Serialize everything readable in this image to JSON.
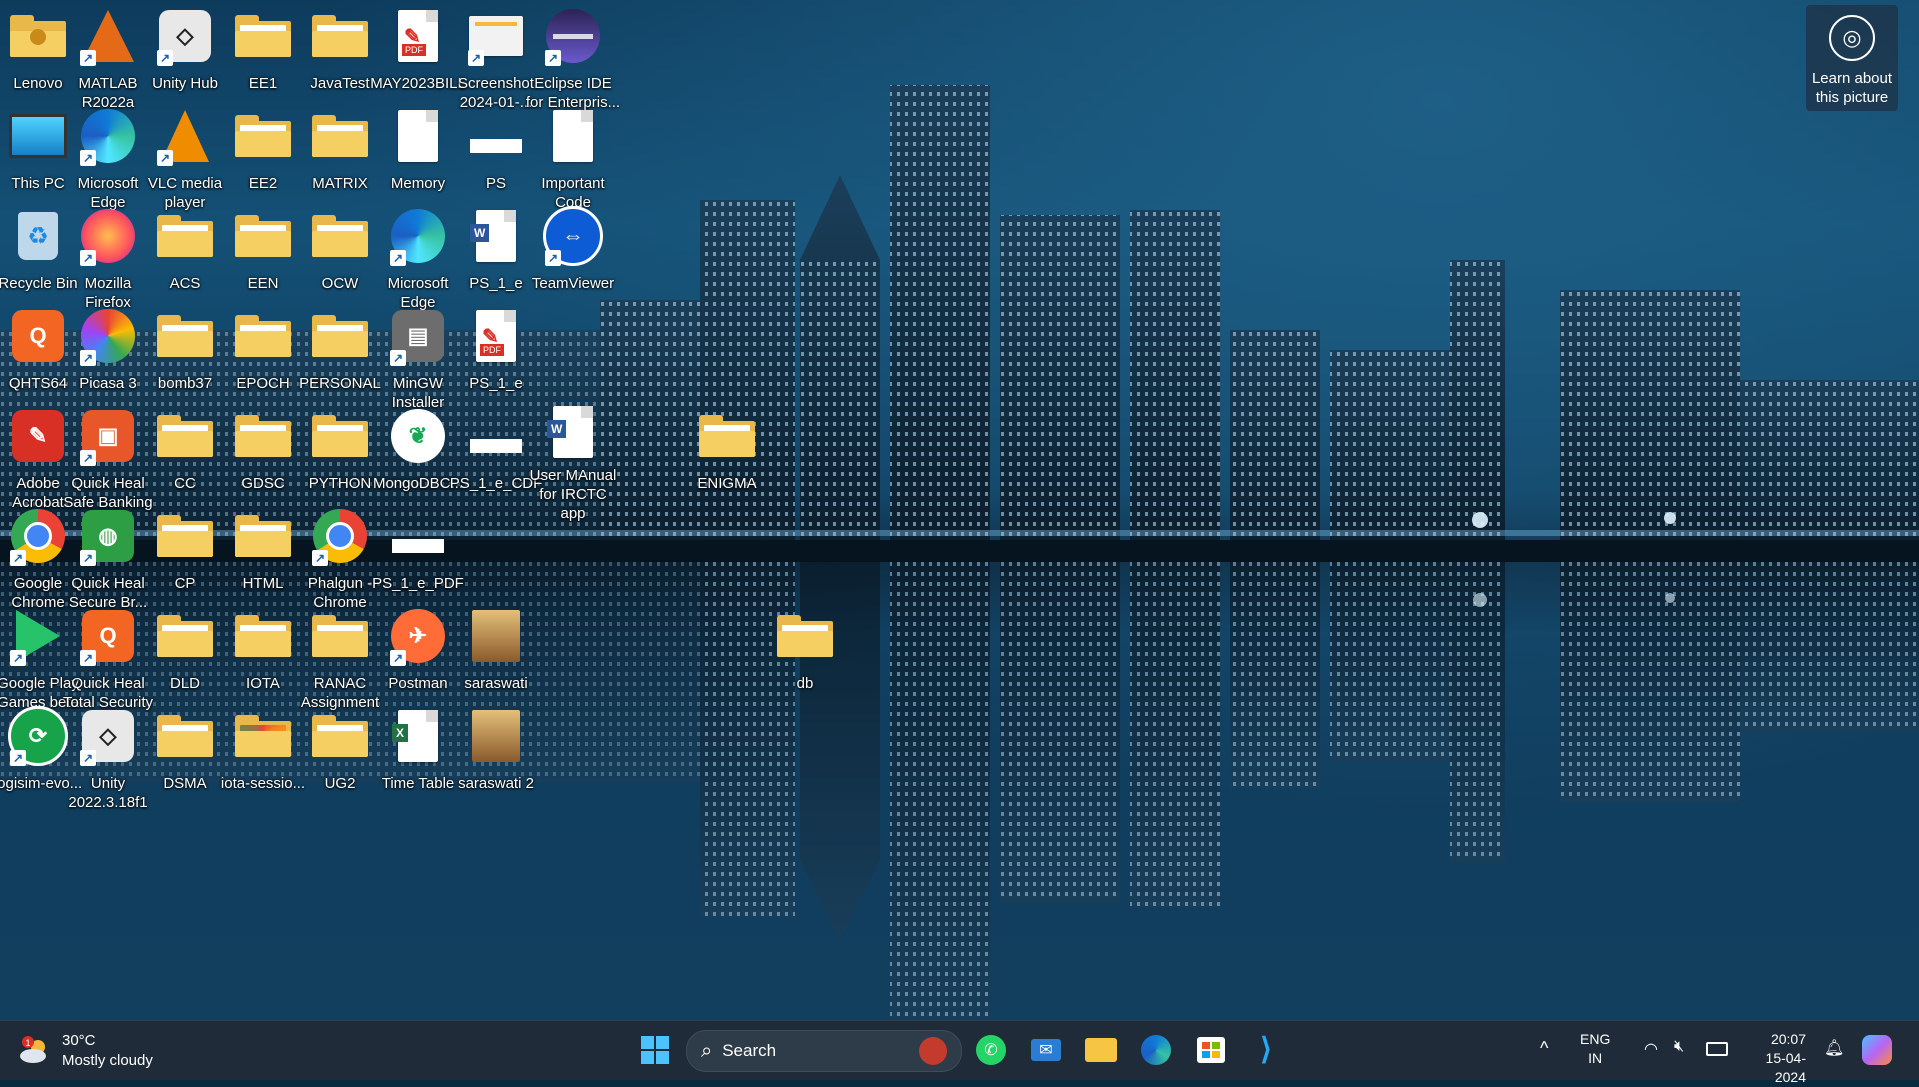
{
  "desktop": {
    "icons": [
      {
        "label": "Lenovo",
        "kind": "user-folder",
        "shortcut": false
      },
      {
        "label": "MATLAB R2022a",
        "kind": "matlab",
        "shortcut": true
      },
      {
        "label": "Unity Hub",
        "kind": "unity",
        "shortcut": true
      },
      {
        "label": "EE1",
        "kind": "folder",
        "shortcut": false
      },
      {
        "label": "JavaTest",
        "kind": "folder",
        "shortcut": false
      },
      {
        "label": "MAY2023BILL",
        "kind": "pdf",
        "shortcut": false
      },
      {
        "label": "Screenshot 2024-01-...",
        "kind": "image",
        "shortcut": true
      },
      {
        "label": "Eclipse IDE for Enterpris...",
        "kind": "eclipse",
        "shortcut": true
      },
      {
        "label": "This PC",
        "kind": "monitor",
        "shortcut": false
      },
      {
        "label": "Microsoft Edge",
        "kind": "edge",
        "shortcut": true
      },
      {
        "label": "VLC media player",
        "kind": "vlc",
        "shortcut": true
      },
      {
        "label": "EE2",
        "kind": "folder",
        "shortcut": false
      },
      {
        "label": "MATRIX",
        "kind": "folder",
        "shortcut": false
      },
      {
        "label": "Memory",
        "kind": "doc",
        "shortcut": false
      },
      {
        "label": "PS",
        "kind": "blank",
        "shortcut": false
      },
      {
        "label": "Important Code",
        "kind": "doc",
        "shortcut": false
      },
      {
        "label": "Recycle Bin",
        "kind": "recycle",
        "shortcut": false
      },
      {
        "label": "Mozilla Firefox",
        "kind": "firefox",
        "shortcut": true
      },
      {
        "label": "ACS",
        "kind": "folder",
        "shortcut": false
      },
      {
        "label": "EEN",
        "kind": "folder",
        "shortcut": false
      },
      {
        "label": "OCW",
        "kind": "folder",
        "shortcut": false
      },
      {
        "label": "Microsoft Edge",
        "kind": "edge",
        "shortcut": true
      },
      {
        "label": "PS_1_e",
        "kind": "word",
        "shortcut": false
      },
      {
        "label": "TeamViewer",
        "kind": "teamviewer",
        "shortcut": true
      },
      {
        "label": "QHTS64",
        "kind": "qh-orange",
        "shortcut": false
      },
      {
        "label": "Picasa 3",
        "kind": "picasa",
        "shortcut": true
      },
      {
        "label": "bomb37",
        "kind": "folder",
        "shortcut": false
      },
      {
        "label": "EPOCH",
        "kind": "folder",
        "shortcut": false
      },
      {
        "label": "PERSONAL",
        "kind": "folder",
        "shortcut": false
      },
      {
        "label": "MinGW Installer",
        "kind": "mingw",
        "shortcut": true
      },
      {
        "label": "PS_1_e",
        "kind": "pdf",
        "shortcut": false
      },
      {
        "label": "Adobe Acrobat",
        "kind": "acrobat",
        "shortcut": false
      },
      {
        "label": "Quick Heal Safe Banking",
        "kind": "qh-bank",
        "shortcut": true
      },
      {
        "label": "CC",
        "kind": "folder",
        "shortcut": false
      },
      {
        "label": "GDSC",
        "kind": "folder",
        "shortcut": false
      },
      {
        "label": "PYTHON",
        "kind": "folder",
        "shortcut": false
      },
      {
        "label": "MongoDBC...",
        "kind": "mongo",
        "shortcut": false
      },
      {
        "label": "PS_1_e_CDF",
        "kind": "blank",
        "shortcut": false
      },
      {
        "label": "User MAnual for IRCTC app",
        "kind": "word",
        "shortcut": false
      },
      {
        "label": "ENIGMA",
        "kind": "folder",
        "shortcut": false
      },
      {
        "label": "Google Chrome",
        "kind": "chrome",
        "shortcut": true
      },
      {
        "label": "Quick Heal Secure Br...",
        "kind": "qh-globe",
        "shortcut": true
      },
      {
        "label": "CP",
        "kind": "folder",
        "shortcut": false
      },
      {
        "label": "HTML",
        "kind": "folder",
        "shortcut": false
      },
      {
        "label": "Phalgun - Chrome",
        "kind": "chrome-p",
        "shortcut": true
      },
      {
        "label": "PS_1_e_PDF",
        "kind": "blank",
        "shortcut": false
      },
      {
        "label": "Google Play Games beta",
        "kind": "gplay",
        "shortcut": true
      },
      {
        "label": "Quick Heal Total Security",
        "kind": "qh-q",
        "shortcut": true
      },
      {
        "label": "DLD",
        "kind": "folder",
        "shortcut": false
      },
      {
        "label": "IOTA",
        "kind": "folder",
        "shortcut": false
      },
      {
        "label": "RANAC Assignment",
        "kind": "folder",
        "shortcut": false
      },
      {
        "label": "Postman",
        "kind": "postman",
        "shortcut": true
      },
      {
        "label": "saraswati",
        "kind": "photo",
        "shortcut": false
      },
      {
        "label": "db",
        "kind": "folder",
        "shortcut": false
      },
      {
        "label": "logisim-evo...",
        "kind": "logisim",
        "shortcut": true
      },
      {
        "label": "Unity 2022.3.18f1",
        "kind": "unity",
        "shortcut": true
      },
      {
        "label": "DSMA",
        "kind": "folder",
        "shortcut": false
      },
      {
        "label": "iota-sessio...",
        "kind": "chrome-folder",
        "shortcut": false
      },
      {
        "label": "UG2",
        "kind": "folder-plain",
        "shortcut": false
      },
      {
        "label": "Time Table",
        "kind": "excel",
        "shortcut": false
      },
      {
        "label": "saraswati 2",
        "kind": "photo",
        "shortcut": false
      }
    ],
    "learn_picture": {
      "label": "Learn about this picture",
      "icon": "camera-lens-icon"
    }
  },
  "taskbar": {
    "weather": {
      "badge": "1",
      "temp": "30°C",
      "condition": "Mostly cloudy"
    },
    "start_icon": "windows-logo-icon",
    "search": {
      "placeholder": "Search"
    },
    "pinned": [
      "whatsapp",
      "mail",
      "file-explorer",
      "edge",
      "microsoft-store",
      "vscode"
    ],
    "tray": {
      "chevron": "^",
      "lang_top": "ENG",
      "lang_bottom": "IN",
      "time": "20:07",
      "date": "15-04-2024"
    }
  },
  "colors": {
    "taskbar_bg": "#1f2b38",
    "folder": "#f6cf63",
    "accent_blue": "#1a73e8"
  }
}
